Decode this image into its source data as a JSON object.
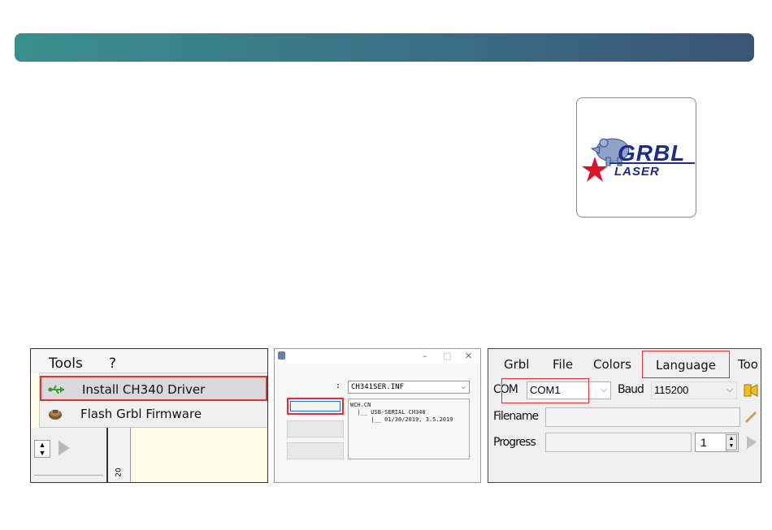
{
  "header": {
    "accent_gradient": [
      "#3a8f8c",
      "#3a5475"
    ]
  },
  "logo": {
    "word_top": "GRBL",
    "word_bottom": "LASER",
    "brand_color": "#1c2b8c",
    "star_color": "#e0102a"
  },
  "shot1": {
    "menus": [
      "Tools",
      "?"
    ],
    "dropdown": [
      {
        "icon": "usb-icon",
        "label": "Install CH340 Driver",
        "highlighted": true
      },
      {
        "icon": "chip-icon",
        "label": "Flash Grbl Firmware",
        "highlighted": false
      }
    ],
    "ruler_label": "20"
  },
  "shot2": {
    "window_controls": [
      "–",
      "□",
      "✕"
    ],
    "colon": ":",
    "inf_file": "CH341SER.INF",
    "info_lines": [
      "WCH.CN",
      "  |__ USB-SERIAL CH340",
      "      |__ 01/30/2019, 3.5.2019"
    ]
  },
  "shot3": {
    "menus": [
      "Grbl",
      "File",
      "Colors",
      "Language",
      "Too"
    ],
    "com_label": "COM",
    "com_value": "COM1",
    "baud_label": "Baud",
    "baud_value": "115200",
    "filename_label": "Filename",
    "progress_label": "Progress",
    "progress_spin_value": "1"
  },
  "highlight_color": "#e03030"
}
